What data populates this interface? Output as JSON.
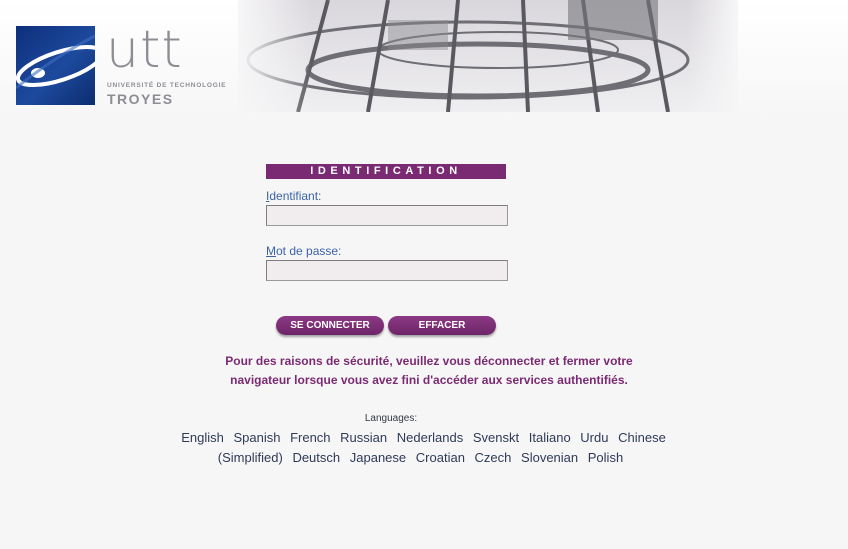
{
  "header": {
    "logo_word": "utt",
    "logo_sub": "UNIVERSITÉ DE TECHNOLOGIE",
    "logo_city": "TROYES"
  },
  "form": {
    "title": "IDENTIFICATION",
    "user_label_first": "I",
    "user_label_rest": "dentifiant:",
    "user_value": "",
    "pass_label_first": "M",
    "pass_label_rest": "ot de passe:",
    "pass_value": "",
    "connect_label": "SE CONNECTER",
    "clear_label": "EFFACER"
  },
  "security_message": {
    "line1": "Pour des raisons de sécurité, veuillez vous déconnecter et fermer votre",
    "line2": "navigateur lorsque vous avez fini d'accéder aux services authentifiés."
  },
  "languages": {
    "label": "Languages:",
    "items": [
      "English",
      "Spanish",
      "French",
      "Russian",
      "Nederlands",
      "Svenskt",
      "Italiano",
      "Urdu",
      "Chinese (Simplified)",
      "Deutsch",
      "Japanese",
      "Croatian",
      "Czech",
      "Slovenian",
      "Polish"
    ]
  },
  "colors": {
    "accent": "#7a2a72",
    "link": "#3a63a8",
    "logo_blue": "#1d4a9e"
  }
}
